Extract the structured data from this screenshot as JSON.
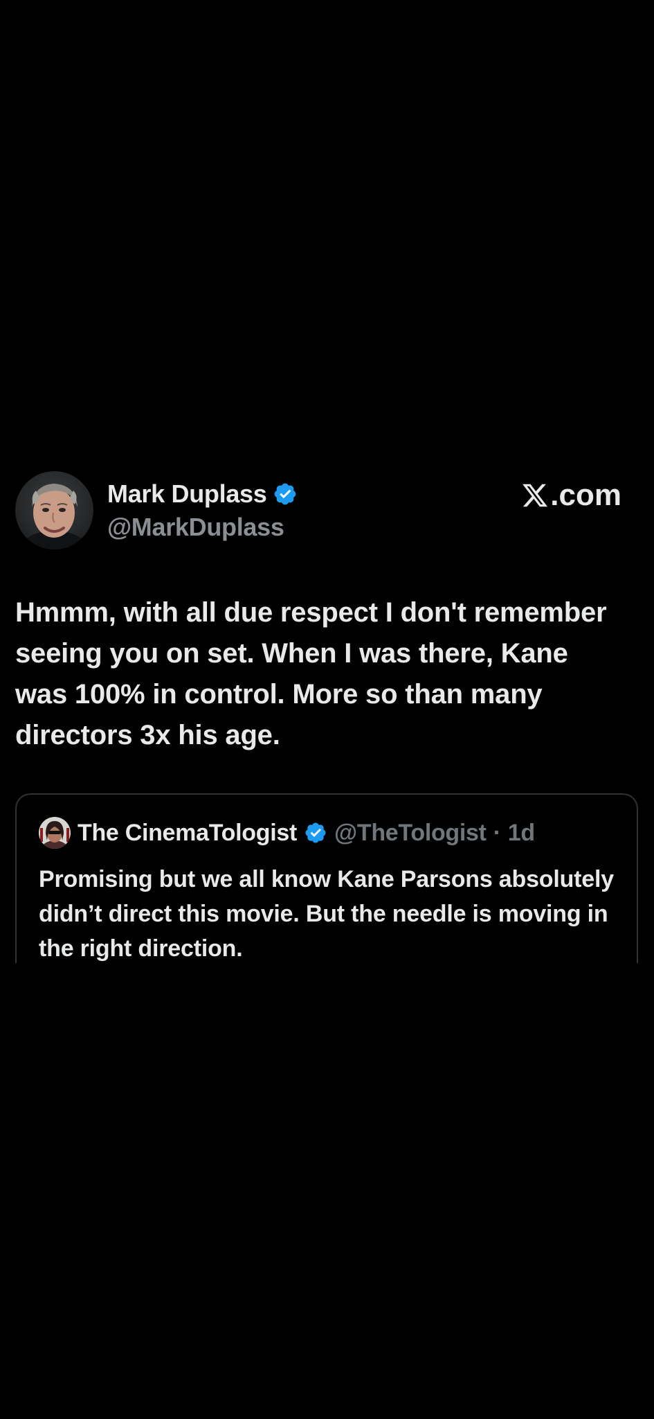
{
  "post": {
    "author": {
      "display_name": "Mark Duplass",
      "handle": "@MarkDuplass",
      "verified": true,
      "avatar_icon": "profile-photo"
    },
    "site_label": ".com",
    "site_logo_icon": "x-logo",
    "text": "Hmmm, with all due respect I don't remember seeing you on set. When I was there, Kane was 100% in control. More so than many directors 3x his age."
  },
  "quoted_post": {
    "author": {
      "display_name": "The CinemaTologist",
      "handle": "@TheTologist",
      "verified": true,
      "avatar_icon": "profile-photo"
    },
    "separator": "·",
    "time": "1d",
    "text": "Promising but we all know Kane Parsons absolutely didn’t direct this movie. But the needle is moving in the right direction."
  },
  "colors": {
    "background": "#000000",
    "primary_text": "#e7e9ea",
    "secondary_text": "#71767b",
    "verified_blue": "#1d9bf0",
    "card_border": "#2f3336"
  }
}
